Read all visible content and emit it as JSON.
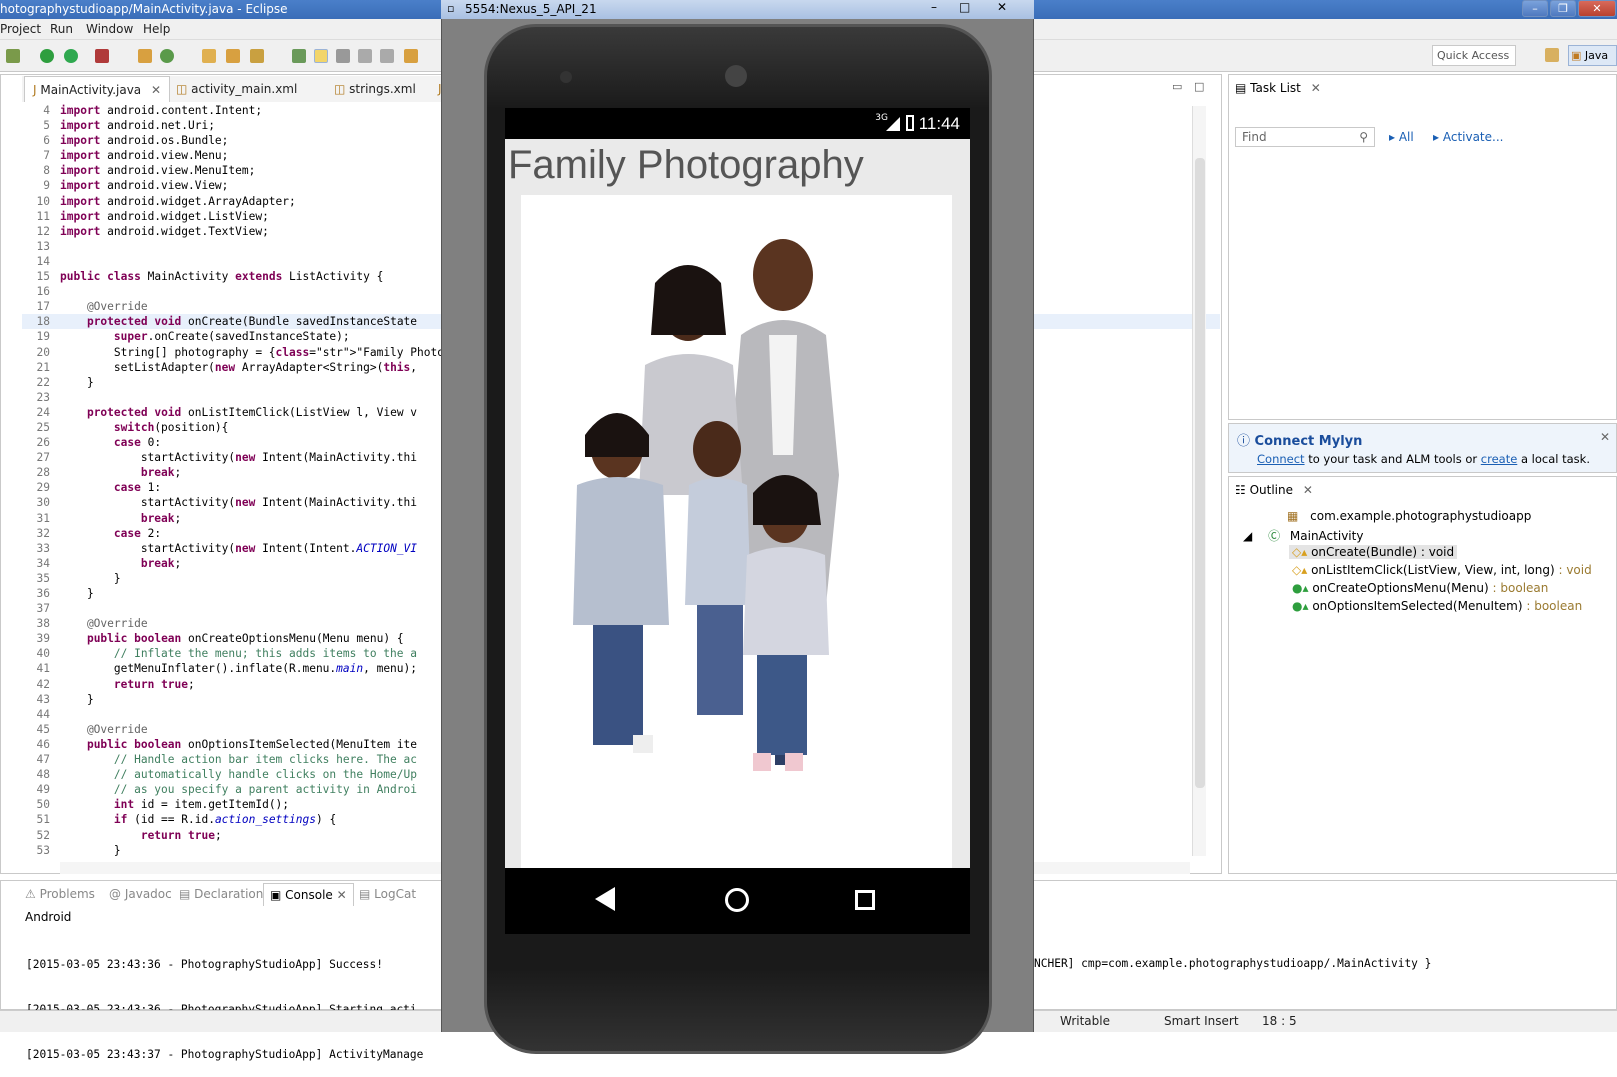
{
  "window": {
    "title": "hotographystudioapp/MainActivity.java - Eclipse"
  },
  "menu": [
    "Project",
    "Run",
    "Window",
    "Help"
  ],
  "toolbar": {
    "quick_access": "Quick Access",
    "perspective": "Java"
  },
  "editor": {
    "tabs": [
      "MainActivity.java",
      "activity_main.xml",
      "strings.xml"
    ],
    "lines": [
      {
        "n": "4",
        "text": "import android.content.Intent;"
      },
      {
        "n": "5",
        "text": "import android.net.Uri;"
      },
      {
        "n": "6",
        "text": "import android.os.Bundle;"
      },
      {
        "n": "7",
        "text": "import android.view.Menu;"
      },
      {
        "n": "8",
        "text": "import android.view.MenuItem;"
      },
      {
        "n": "9",
        "text": "import android.view.View;"
      },
      {
        "n": "10",
        "text": "import android.widget.ArrayAdapter;"
      },
      {
        "n": "11",
        "text": "import android.widget.ListView;"
      },
      {
        "n": "12",
        "text": "import android.widget.TextView;"
      },
      {
        "n": "13",
        "text": ""
      },
      {
        "n": "14",
        "text": ""
      },
      {
        "n": "15",
        "text": "public class MainActivity extends ListActivity {"
      },
      {
        "n": "16",
        "text": ""
      },
      {
        "n": "17",
        "text": "    @Override"
      },
      {
        "n": "18",
        "text": "    protected void onCreate(Bundle savedInstanceState"
      },
      {
        "n": "19",
        "text": "        super.onCreate(savedInstanceState);"
      },
      {
        "n": "20",
        "text": "        String[] photography = {\"Family Photography\","
      },
      {
        "n": "21",
        "text": "        setListAdapter(new ArrayAdapter<String>(this,"
      },
      {
        "n": "22",
        "text": "    }"
      },
      {
        "n": "23",
        "text": ""
      },
      {
        "n": "24",
        "text": "    protected void onListItemClick(ListView l, View v"
      },
      {
        "n": "25",
        "text": "        switch(position){"
      },
      {
        "n": "26",
        "text": "        case 0:"
      },
      {
        "n": "27",
        "text": "            startActivity(new Intent(MainActivity.thi"
      },
      {
        "n": "28",
        "text": "            break;"
      },
      {
        "n": "29",
        "text": "        case 1:"
      },
      {
        "n": "30",
        "text": "            startActivity(new Intent(MainActivity.thi"
      },
      {
        "n": "31",
        "text": "            break;"
      },
      {
        "n": "32",
        "text": "        case 2:"
      },
      {
        "n": "33",
        "text": "            startActivity(new Intent(Intent.ACTION_VI"
      },
      {
        "n": "34",
        "text": "            break;"
      },
      {
        "n": "35",
        "text": "        }"
      },
      {
        "n": "36",
        "text": "    }"
      },
      {
        "n": "37",
        "text": ""
      },
      {
        "n": "38",
        "text": "    @Override"
      },
      {
        "n": "39",
        "text": "    public boolean onCreateOptionsMenu(Menu menu) {"
      },
      {
        "n": "40",
        "text": "        // Inflate the menu; this adds items to the a"
      },
      {
        "n": "41",
        "text": "        getMenuInflater().inflate(R.menu.main, menu);"
      },
      {
        "n": "42",
        "text": "        return true;"
      },
      {
        "n": "43",
        "text": "    }"
      },
      {
        "n": "44",
        "text": ""
      },
      {
        "n": "45",
        "text": "    @Override"
      },
      {
        "n": "46",
        "text": "    public boolean onOptionsItemSelected(MenuItem ite"
      },
      {
        "n": "47",
        "text": "        // Handle action bar item clicks here. The ac"
      },
      {
        "n": "48",
        "text": "        // automatically handle clicks on the Home/Up"
      },
      {
        "n": "49",
        "text": "        // as you specify a parent activity in Androi"
      },
      {
        "n": "50",
        "text": "        int id = item.getItemId();"
      },
      {
        "n": "51",
        "text": "        if (id == R.id.action_settings) {"
      },
      {
        "n": "52",
        "text": "            return true;"
      },
      {
        "n": "53",
        "text": "        }"
      }
    ]
  },
  "emulator": {
    "title": "5554:Nexus_5_API_21",
    "clock": "11:44",
    "network": "3G",
    "app_title": "Family Photography"
  },
  "tasklist": {
    "title": "Task List",
    "find_placeholder": "Find",
    "all": "All",
    "activate": "Activate..."
  },
  "mylyn": {
    "title": "Connect Mylyn",
    "connect": "Connect",
    "middle": " to your task and ALM tools or ",
    "create": "create",
    "end": " a local task."
  },
  "outline": {
    "title": "Outline",
    "package": "com.example.photographystudioapp",
    "class": "MainActivity",
    "methods": [
      {
        "name": "onCreate(Bundle) : void"
      },
      {
        "name": "onListItemClick(ListView, View, int, long)",
        "ret": " : void"
      },
      {
        "name": "onCreateOptionsMenu(Menu)",
        "ret": " : boolean"
      },
      {
        "name": "onOptionsItemSelected(MenuItem)",
        "ret": " : boolean"
      }
    ]
  },
  "console": {
    "tabs": [
      "Problems",
      "Javadoc",
      "Declaration",
      "Console",
      "LogCat"
    ],
    "header": "Android",
    "lines": [
      "[2015-03-05 23:43:36 - PhotographyStudioApp] Success!",
      "[2015-03-05 23:43:36 - PhotographyStudioApp] Starting acti",
      "[2015-03-05 23:43:37 - PhotographyStudioApp] ActivityManage"
    ],
    "tail": "NCHER] cmp=com.example.photographystudioapp/.MainActivity }"
  },
  "status": {
    "writable": "Writable",
    "insert": "Smart Insert",
    "position": "18 : 5"
  }
}
